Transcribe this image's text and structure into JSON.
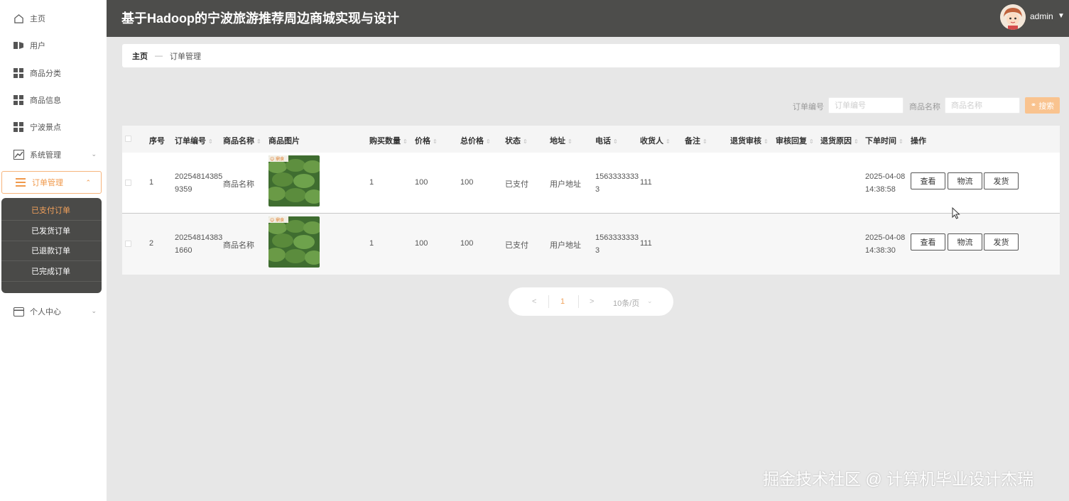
{
  "header": {
    "title": "基于Hadoop的宁波旅游推荐周边商城实现与设计",
    "user": "admin"
  },
  "sidebar": {
    "items": [
      {
        "label": "主页"
      },
      {
        "label": "用户"
      },
      {
        "label": "商品分类"
      },
      {
        "label": "商品信息"
      },
      {
        "label": "宁波景点"
      },
      {
        "label": "系统管理"
      },
      {
        "label": "订单管理"
      },
      {
        "label": "个人中心"
      }
    ],
    "submenu": [
      {
        "label": "已支付订单"
      },
      {
        "label": "已发货订单"
      },
      {
        "label": "已退款订单"
      },
      {
        "label": "已完成订单"
      }
    ]
  },
  "breadcrumb": {
    "home": "主页",
    "separator": "—",
    "current": "订单管理"
  },
  "search": {
    "order_no_label": "订单编号",
    "order_no_placeholder": "订单编号",
    "product_name_label": "商品名称",
    "product_name_placeholder": "商品名称",
    "button": "搜索"
  },
  "table": {
    "columns": [
      "序号",
      "订单编号",
      "商品名称",
      "商品图片",
      "购买数量",
      "价格",
      "总价格",
      "状态",
      "地址",
      "电话",
      "收货人",
      "备注",
      "退货审核",
      "审核回复",
      "退货原因",
      "下单时间",
      "操作"
    ],
    "rows": [
      {
        "index": "1",
        "order_no": "202548143859359",
        "product": "商品名称",
        "img_tag": "☺ 鼎食",
        "qty": "1",
        "price": "100",
        "total": "100",
        "status": "已支付",
        "address": "用户地址",
        "phone": "15633333333",
        "receiver": "111",
        "remark": "",
        "return_audit": "",
        "audit_reply": "",
        "return_reason": "",
        "time": "2025-04-08 14:38:58"
      },
      {
        "index": "2",
        "order_no": "202548143831660",
        "product": "商品名称",
        "img_tag": "☺ 鼎食",
        "qty": "1",
        "price": "100",
        "total": "100",
        "status": "已支付",
        "address": "用户地址",
        "phone": "15633333333",
        "receiver": "111",
        "remark": "",
        "return_audit": "",
        "audit_reply": "",
        "return_reason": "",
        "time": "2025-04-08 14:38:30"
      }
    ],
    "actions": {
      "view": "查看",
      "logistics": "物流",
      "ship": "发货"
    }
  },
  "pagination": {
    "prev": "<",
    "page": "1",
    "next": ">",
    "page_size": "10条/页"
  },
  "watermark": "掘金技术社区 @ 计算机毕业设计杰瑞",
  "colors": {
    "accent": "#f0994b",
    "header_bg": "#4d4d4b",
    "submenu_bg": "#4a4a48"
  }
}
